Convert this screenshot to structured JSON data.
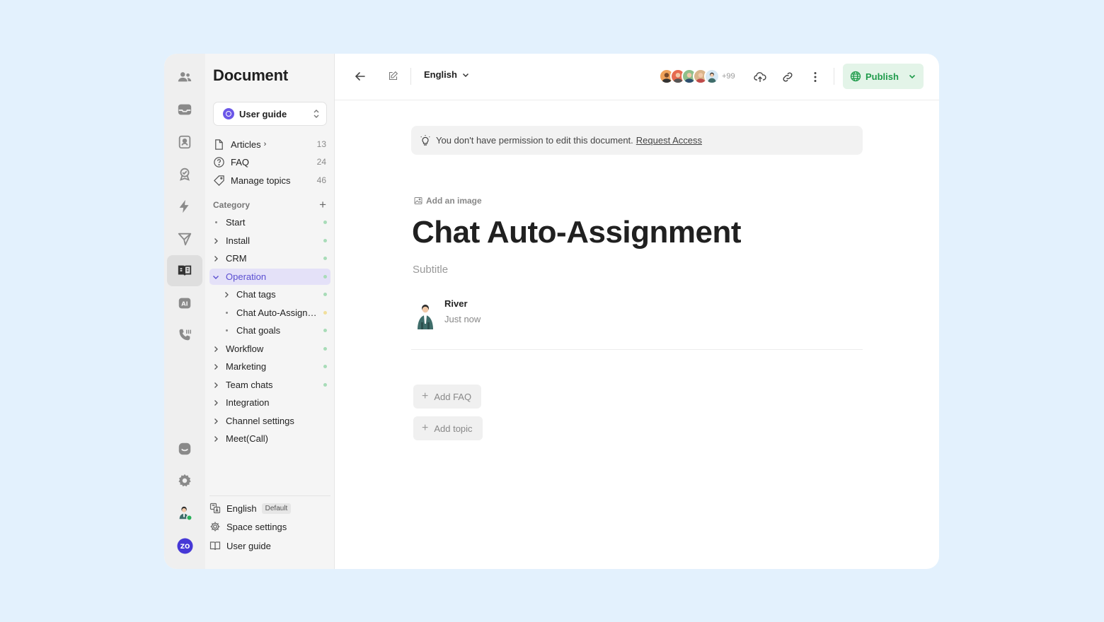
{
  "sidebar": {
    "title": "Document",
    "space": "User guide",
    "nav": [
      {
        "label": "Articles",
        "count": "13"
      },
      {
        "label": "FAQ",
        "count": "24"
      },
      {
        "label": "Manage topics",
        "count": "46"
      }
    ],
    "category_heading": "Category",
    "categories": [
      {
        "label": "Start",
        "dot": "#a8dcb8"
      },
      {
        "label": "Install",
        "dot": "#a8dcb8"
      },
      {
        "label": "CRM",
        "dot": "#a8dcb8"
      },
      {
        "label": "Operation",
        "dot": "#a8dcb8"
      },
      {
        "label": "Chat tags",
        "dot": "#a8dcb8"
      },
      {
        "label": "Chat Auto-Assignment",
        "dot": "#f1df9c"
      },
      {
        "label": "Chat goals",
        "dot": "#a8dcb8"
      },
      {
        "label": "Workflow",
        "dot": "#a8dcb8"
      },
      {
        "label": "Marketing",
        "dot": "#a8dcb8"
      },
      {
        "label": "Team chats",
        "dot": "#a8dcb8"
      },
      {
        "label": "Integration"
      },
      {
        "label": "Channel settings"
      },
      {
        "label": "Meet(Call)"
      }
    ],
    "footer": {
      "language": "English",
      "language_badge": "Default",
      "space_settings": "Space settings",
      "user_guide": "User guide"
    }
  },
  "topbar": {
    "language": "English",
    "more_count": "+99",
    "publish": "Publish"
  },
  "notice": {
    "text": "You don't have permission to edit this document.",
    "link": "Request Access"
  },
  "doc": {
    "add_image": "Add an image",
    "title": "Chat Auto-Assignment",
    "subtitle": "Subtitle",
    "author": "River",
    "time": "Just now",
    "add_faq": "Add FAQ",
    "add_topic": "Add topic"
  },
  "colors": {
    "accent": "#5b4fd1",
    "publish": "#1f9b4b",
    "brand": "#4638d6"
  },
  "rail_icons": [
    "contacts-icon",
    "inbox-icon",
    "profile-icon",
    "badge-icon",
    "bolt-icon",
    "send-icon",
    "document-icon",
    "ai-icon",
    "phone-icon",
    "chat-icon",
    "settings-icon",
    "user-avatar",
    "brand-logo"
  ]
}
